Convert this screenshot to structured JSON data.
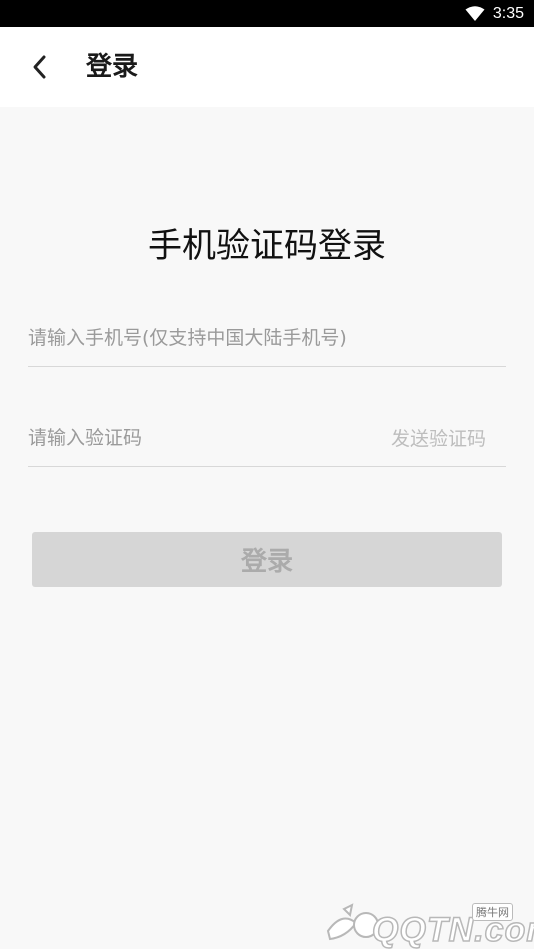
{
  "status_bar": {
    "time": "3:35"
  },
  "nav": {
    "title": "登录"
  },
  "heading": "手机验证码登录",
  "form": {
    "phone_placeholder": "请输入手机号(仅支持中国大陆手机号)",
    "phone_value": "",
    "code_placeholder": "请输入验证码",
    "code_value": "",
    "send_code_label": "发送验证码"
  },
  "login_button_label": "登录",
  "watermark": {
    "site": "QQTN.com",
    "badge": "腾牛网"
  },
  "colors": {
    "background": "#f8f8f8",
    "button_disabled": "#d6d6d6",
    "button_text_disabled": "#ababab",
    "send_code_disabled": "#bdbdbd"
  },
  "icons": {
    "back": "chevron-left-icon",
    "wifi": "wifi-icon"
  }
}
